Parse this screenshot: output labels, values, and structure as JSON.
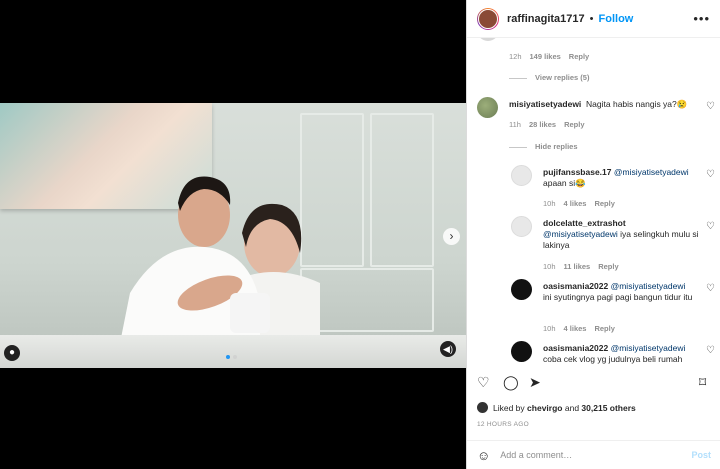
{
  "post": {
    "username": "raffinagita1717",
    "follow_label": "Follow",
    "more": "•••"
  },
  "comments": [
    {
      "meta_time": "12h",
      "meta_likes": "149 likes",
      "reply": "Reply",
      "thread_toggle": "View replies (5)"
    },
    {
      "user": "misiyatisetyadewi",
      "text": "Nagita habis nangis ya?😢",
      "meta_time": "11h",
      "meta_likes": "28 likes",
      "reply": "Reply",
      "thread_toggle": "Hide replies"
    }
  ],
  "replies": [
    {
      "user": "pujifanssbase.17",
      "mention": "@misiyatisetyadewi",
      "text": "apaan si😂",
      "meta_time": "10h",
      "meta_likes": "4 likes",
      "reply": "Reply"
    },
    {
      "user": "dolcelatte_extrashot",
      "mention": "@misiyatisetyadewi",
      "text": "iya selingkuh mulu si lakinya",
      "meta_time": "10h",
      "meta_likes": "11 likes",
      "reply": "Reply"
    },
    {
      "user": "oasismania2022",
      "mention": "@misiyatisetyadewi",
      "text": "ini syutingnya pagi pagi bangun tidur itu",
      "meta_time": "10h",
      "meta_likes": "4 likes",
      "reply": "Reply"
    },
    {
      "user": "oasismania2022",
      "mention": "@misiyatisetyadewi",
      "text": "coba cek vlog yg judulnya beli rumah",
      "meta_time": "",
      "meta_likes": "",
      "reply": ""
    }
  ],
  "likes": {
    "prefix": "Liked by",
    "user": "chevirgo",
    "and": "and",
    "count": "30,215 others"
  },
  "time_ago": "12 HOURS AGO",
  "add_comment": {
    "placeholder": "Add a comment…",
    "post_label": "Post"
  },
  "colors": {
    "accent": "#0095f6",
    "text": "#262626",
    "muted": "#8e8e8e"
  }
}
